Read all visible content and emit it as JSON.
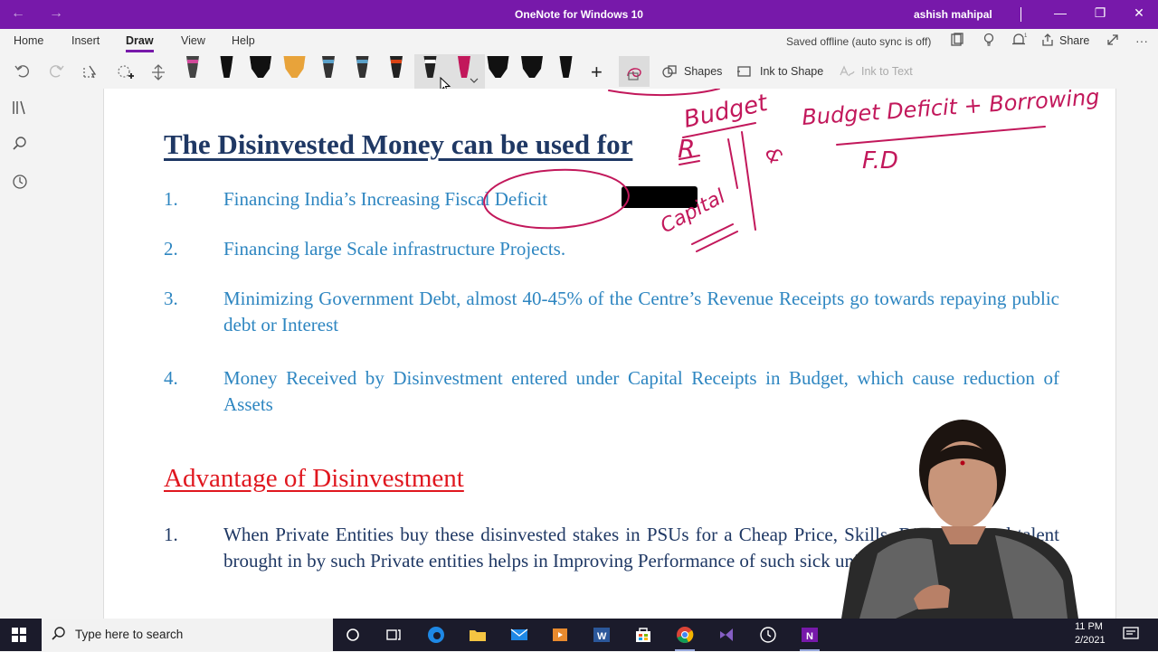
{
  "titlebar": {
    "back_icon": "←",
    "forward_icon": "→",
    "title": "OneNote for Windows 10",
    "user": "ashish mahipal",
    "minimize": "—",
    "restore": "❐",
    "close": "✕"
  },
  "menu": {
    "tabs": [
      "Home",
      "Insert",
      "Draw",
      "View",
      "Help"
    ],
    "active_tab": "Draw",
    "status": "Saved offline (auto sync is off)",
    "share_label": "Share",
    "more": "···"
  },
  "toolbar": {
    "shapes_label": "Shapes",
    "ink_to_shape_label": "Ink to Shape",
    "ink_to_text_label": "Ink to Text",
    "add": "+",
    "pens": [
      {
        "color": "#444444",
        "tip": "#d14a9a"
      },
      {
        "color": "#111111",
        "tip": "#111111"
      },
      {
        "color": "#111111",
        "tip": "#111111"
      },
      {
        "color": "#e8a33a",
        "tip": "#e8a33a"
      },
      {
        "color": "#333333",
        "tip": "#5aa0c8"
      },
      {
        "color": "#333333",
        "tip": "#5aa0c8"
      },
      {
        "color": "#222222",
        "tip": "#d84315"
      },
      {
        "color": "#222222",
        "tip": "#ffffff"
      },
      {
        "color": "#c2185b",
        "tip": "#c2185b"
      },
      {
        "color": "#111111",
        "tip": "#111111"
      },
      {
        "color": "#111111",
        "tip": "#111111"
      },
      {
        "color": "#111111",
        "tip": "#111111"
      }
    ]
  },
  "page": {
    "heading": "The Disinvested Money can be used for",
    "uses": [
      {
        "num": "1.",
        "text": "Financing India’s Increasing Fiscal Deficit"
      },
      {
        "num": "2.",
        "text": "Financing large Scale infrastructure Projects."
      },
      {
        "num": "3.",
        "text": "Minimizing Government Debt, almost 40-45% of the Centre’s Revenue Receipts go towards repaying  public debt or Interest"
      },
      {
        "num": "4.",
        "text": "Money Received by Disinvestment entered under Capital Receipts in Budget, which cause reduction of Assets"
      }
    ],
    "heading2": "Advantage of Disinvestment",
    "advantages": [
      {
        "num": "1.",
        "text": "When Private Entities buy these disinvested stakes in PSUs for a Cheap Price, Skills, Discipline and talent brought in by such Private entities helps in Improving Performance of such sick units."
      }
    ]
  },
  "ink": {
    "budget": "Budget",
    "r": "R",
    "amp": "&",
    "capital": "Capital",
    "budget_deficit": "Budget Deficit + Borrowing",
    "fd": "F.D",
    "color": "#c2185b"
  },
  "taskbar": {
    "search_placeholder": "Type here to search",
    "time": "11 PM",
    "date": "2/2021"
  }
}
